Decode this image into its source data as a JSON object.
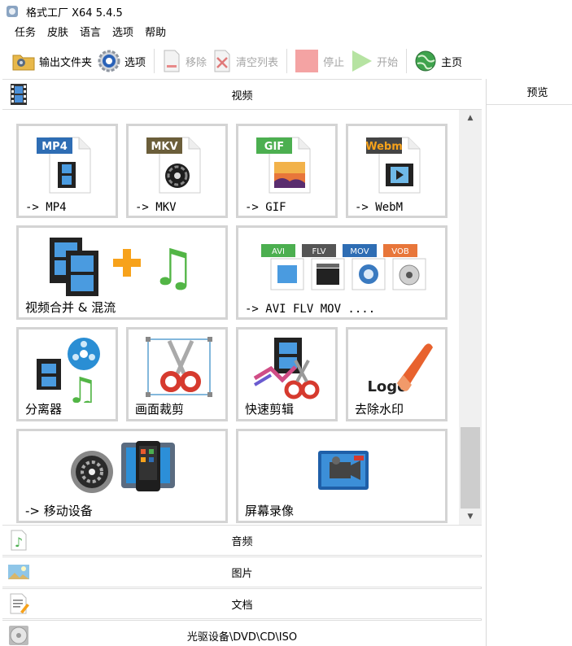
{
  "window": {
    "title": "格式工厂 X64 5.4.5"
  },
  "menu": [
    "任务",
    "皮肤",
    "语言",
    "选项",
    "帮助"
  ],
  "toolbar": {
    "output_folder": "输出文件夹",
    "options": "选项",
    "remove": "移除",
    "clear_list": "清空列表",
    "stop": "停止",
    "start": "开始",
    "home": "主页"
  },
  "categories": {
    "video": "视频",
    "audio": "音频",
    "image": "图片",
    "document": "文档",
    "disc": "光驱设备\\DVD\\CD\\ISO"
  },
  "tiles": {
    "mp4": {
      "label": "-> MP4",
      "badge": "MP4"
    },
    "mkv": {
      "label": "-> MKV",
      "badge": "MKV"
    },
    "gif": {
      "label": "-> GIF",
      "badge": "GIF"
    },
    "webm": {
      "label": "-> WebM",
      "badge": "Webm"
    },
    "merge": {
      "label": "视频合并 & 混流"
    },
    "multi": {
      "label": "-> AVI FLV MOV ....",
      "badges": [
        "AVI",
        "FLV",
        "MOV",
        "VOB"
      ]
    },
    "separator": {
      "label": "分离器"
    },
    "crop": {
      "label": "画面裁剪"
    },
    "quick_cut": {
      "label": "快速剪辑"
    },
    "watermark": {
      "label": "去除水印",
      "logo_text": "Logo"
    },
    "mobile": {
      "label": "-> 移动设备"
    },
    "screen_record": {
      "label": "屏幕录像"
    }
  },
  "preview": {
    "label": "预览"
  },
  "colors": {
    "mp4": "#2e6db4",
    "mkv": "#6b5e3a",
    "gif": "#4caf50",
    "webm": "#444444",
    "accent": "#f7a21b"
  }
}
